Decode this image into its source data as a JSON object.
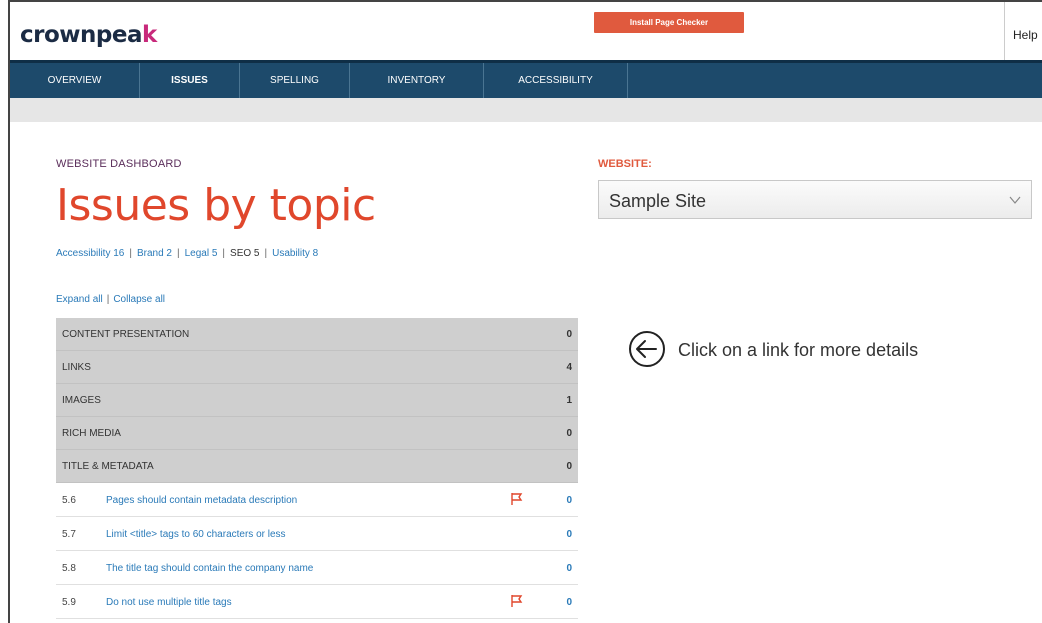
{
  "header": {
    "logo_main": "crownpea",
    "logo_accent": "k",
    "install_button": "Install Page Checker",
    "help": "Help"
  },
  "nav": [
    {
      "label": "OVERVIEW",
      "active": false
    },
    {
      "label": "ISSUES",
      "active": true
    },
    {
      "label": "SPELLING",
      "active": false
    },
    {
      "label": "INVENTORY",
      "active": false
    },
    {
      "label": "ACCESSIBILITY",
      "active": false
    }
  ],
  "main": {
    "eyebrow": "WEBSITE DASHBOARD",
    "title": "Issues by topic",
    "topic_links": [
      {
        "label": "Accessibility 16",
        "link": true
      },
      {
        "label": "Brand 2",
        "link": true
      },
      {
        "label": "Legal 5",
        "link": true
      },
      {
        "label": "SEO 5",
        "link": false
      },
      {
        "label": "Usability 8",
        "link": true
      }
    ],
    "expand_all": "Expand all",
    "collapse_all": "Collapse all",
    "categories": [
      {
        "label": "CONTENT PRESENTATION",
        "count": "0"
      },
      {
        "label": "LINKS",
        "count": "4"
      },
      {
        "label": "IMAGES",
        "count": "1"
      },
      {
        "label": "RICH MEDIA",
        "count": "0"
      },
      {
        "label": "TITLE & METADATA",
        "count": "0"
      }
    ],
    "items": [
      {
        "num": "5.6",
        "text": "Pages should contain metadata description",
        "flag": true,
        "count": "0"
      },
      {
        "num": "5.7",
        "text": "Limit <title> tags to 60 characters or less",
        "flag": false,
        "count": "0"
      },
      {
        "num": "5.8",
        "text": "The title tag should contain the company name",
        "flag": false,
        "count": "0"
      },
      {
        "num": "5.9",
        "text": "Do not use multiple title tags",
        "flag": true,
        "count": "0"
      }
    ]
  },
  "website": {
    "label": "WEBSITE:",
    "selected": "Sample Site"
  },
  "hint": "Click on a link for more details",
  "colors": {
    "accent": "#e0472c",
    "nav": "#1d4a6b",
    "link": "#2a7ab8",
    "flag": "#e0472c"
  }
}
